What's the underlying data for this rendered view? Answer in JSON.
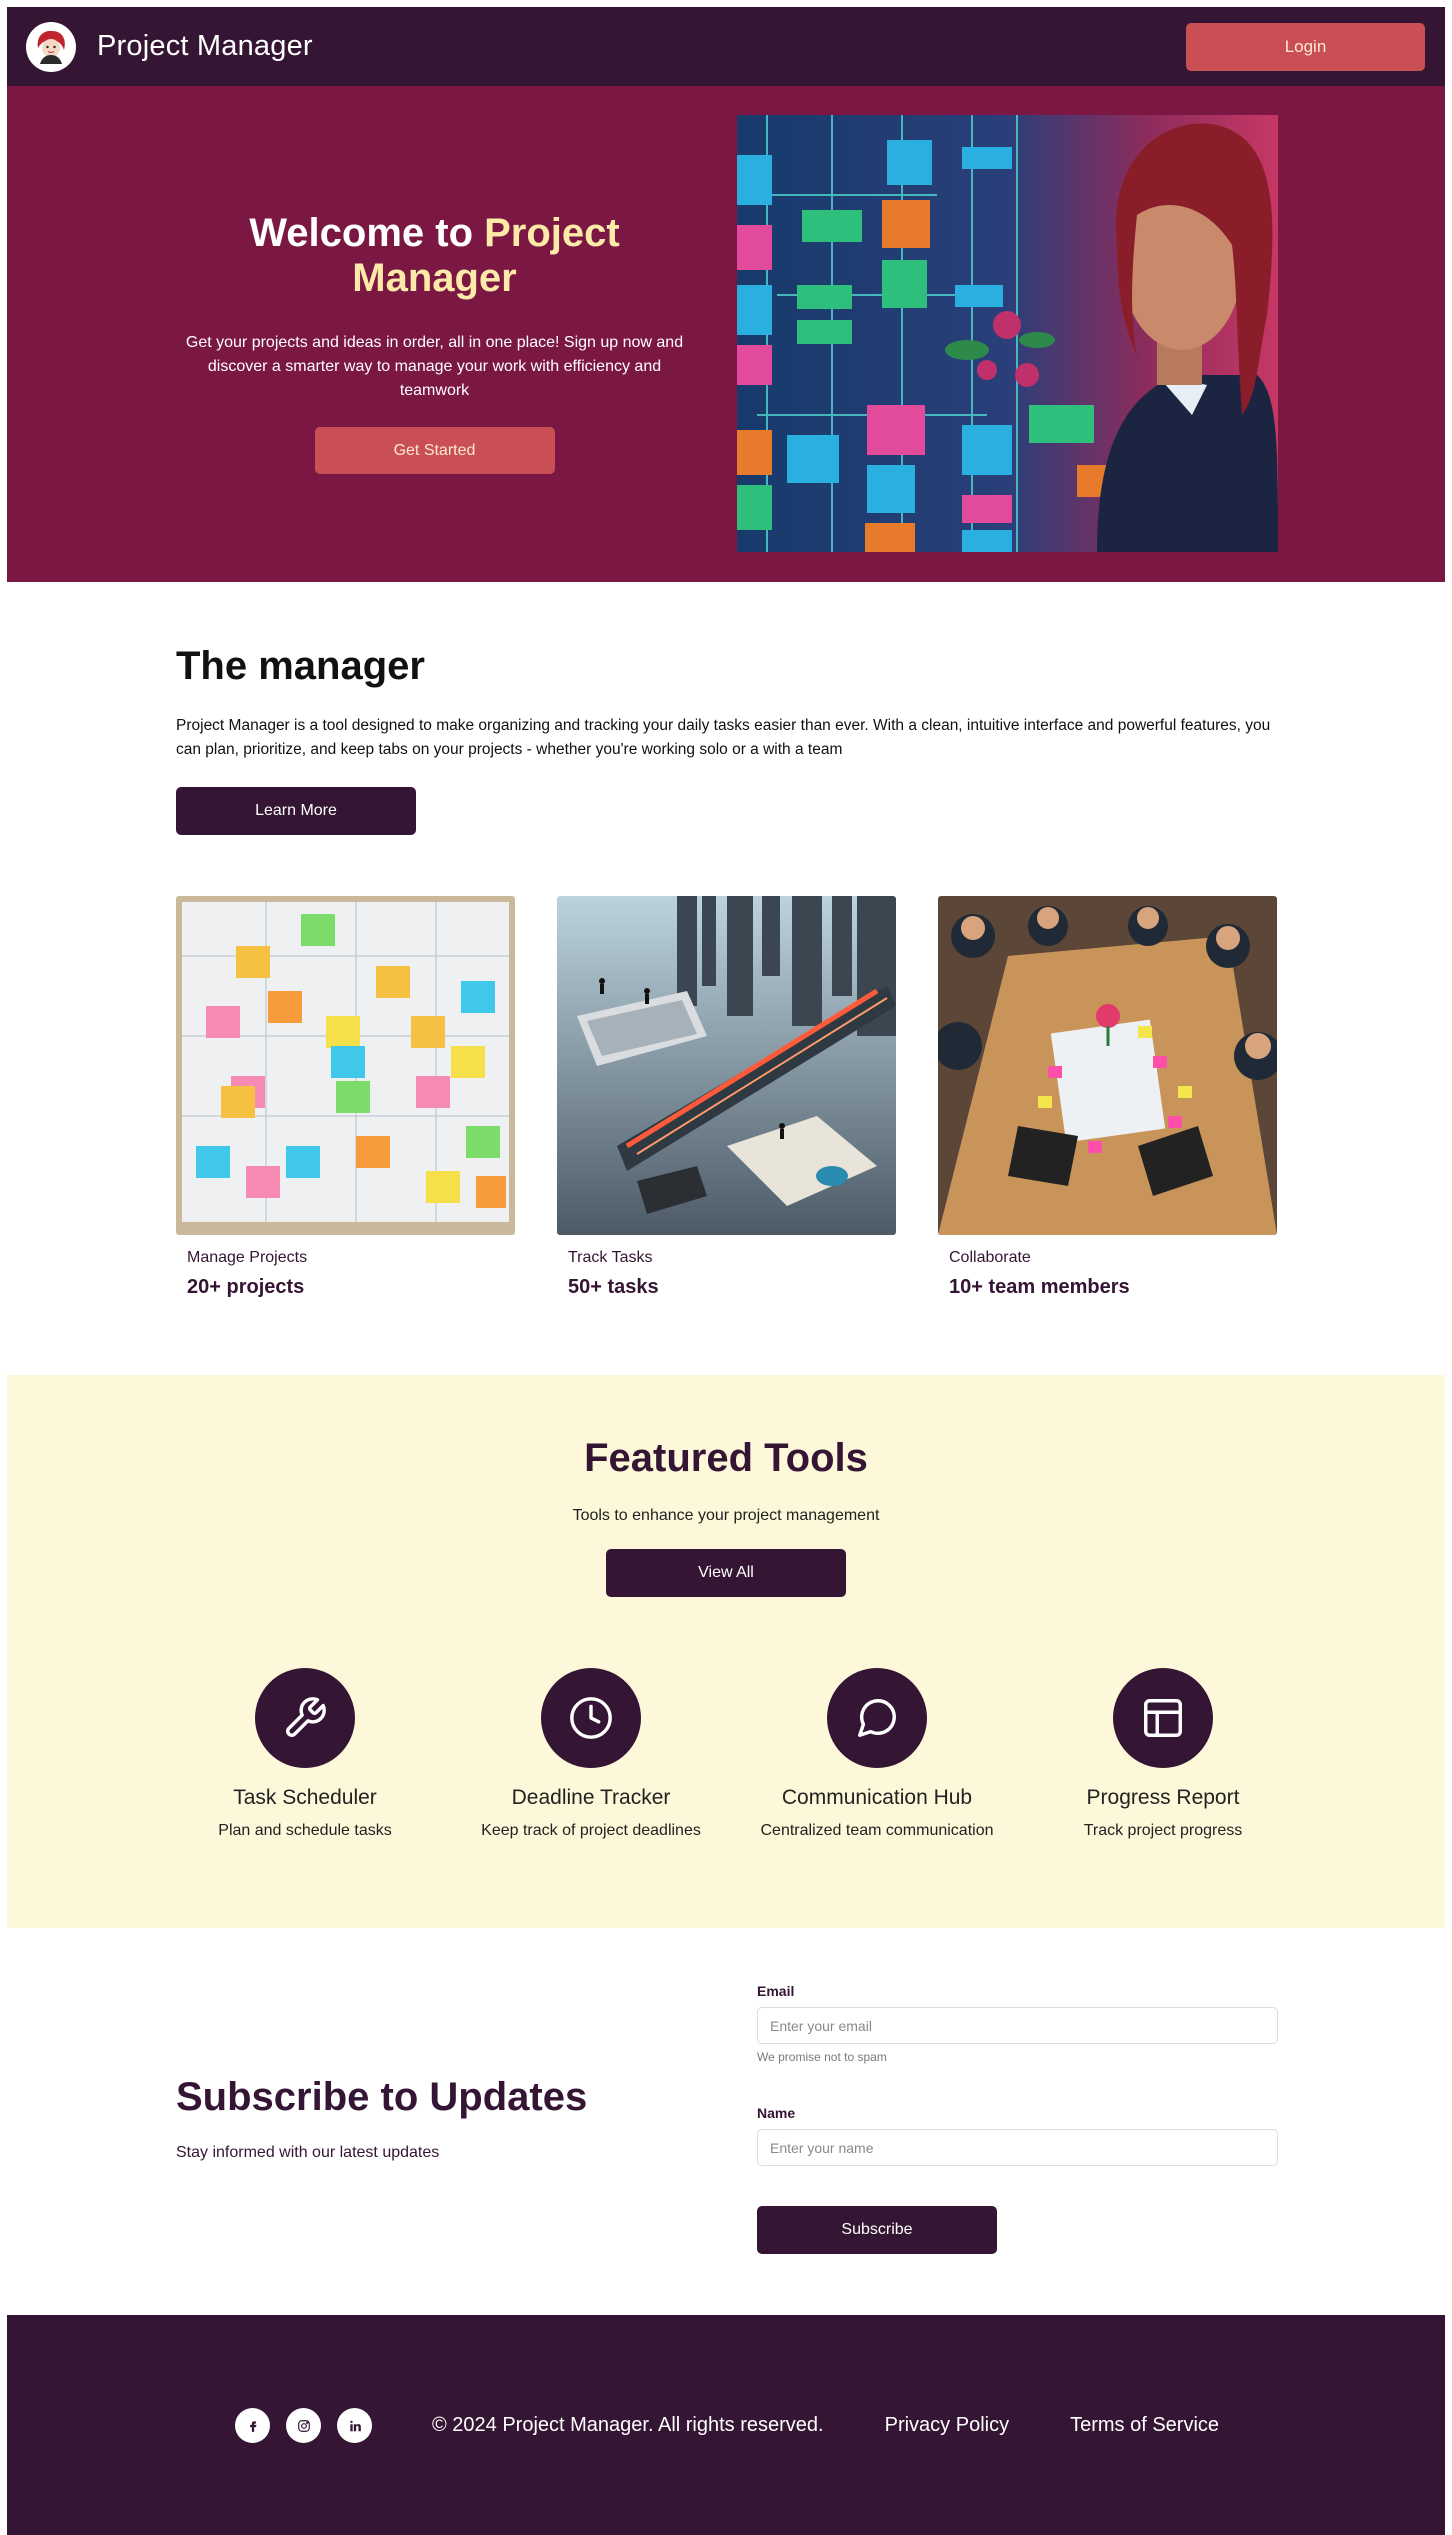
{
  "navbar": {
    "logo_icon": "avatar-logo-icon",
    "title": "Project Manager",
    "login_label": "Login"
  },
  "hero": {
    "title_prefix": "Welcome to ",
    "title_accent": "Project Manager",
    "subtitle": "Get your projects and ideas in order, all in one place! Sign up now and discover a smarter way to manage your work with efficiency and teamwork",
    "cta_label": "Get Started",
    "image": "woman-with-project-dashboard-illustration"
  },
  "manager": {
    "title": "The manager",
    "text": "Project Manager is a tool designed to make organizing and tracking your daily tasks easier than ever. With a clean, intuitive interface and powerful features, you can plan, prioritize, and keep tabs on your projects - whether you're working solo or a with a team",
    "learn_more_label": "Learn More",
    "cards": [
      {
        "label": "Manage Projects",
        "value": "20+ projects",
        "image": "sticky-notes-board-image"
      },
      {
        "label": "Track Tasks",
        "value": "50+ tasks",
        "image": "futuristic-workspace-image"
      },
      {
        "label": "Collaborate",
        "value": "10+ team members",
        "image": "team-meeting-image"
      }
    ]
  },
  "featured": {
    "title": "Featured Tools",
    "subtitle": "Tools to enhance your project management",
    "view_all_label": "View All",
    "tools": [
      {
        "name": "Task Scheduler",
        "desc": "Plan and schedule tasks",
        "icon": "wrench-icon"
      },
      {
        "name": "Deadline Tracker",
        "desc": "Keep track of project deadlines",
        "icon": "clock-icon"
      },
      {
        "name": "Communication Hub",
        "desc": "Centralized team communication",
        "icon": "chat-bubble-icon"
      },
      {
        "name": "Progress Report",
        "desc": "Track project progress",
        "icon": "layout-icon"
      }
    ]
  },
  "subscribe": {
    "title": "Subscribe to Updates",
    "text": "Stay informed with our latest updates",
    "email_label": "Email",
    "email_placeholder": "Enter your email",
    "email_hint": "We promise not to spam",
    "name_label": "Name",
    "name_placeholder": "Enter your name",
    "submit_label": "Subscribe"
  },
  "footer": {
    "socials": [
      "facebook-icon",
      "instagram-icon",
      "linkedin-icon"
    ],
    "copyright": "© 2024 Project Manager. All rights reserved.",
    "privacy_label": "Privacy Policy",
    "terms_label": "Terms of Service"
  },
  "colors": {
    "nav_bg": "#341533",
    "hero_bg": "#7a1742",
    "accent_button": "#c94f55",
    "accent_text": "#fde9a8",
    "featured_bg": "#fdf8d9"
  }
}
